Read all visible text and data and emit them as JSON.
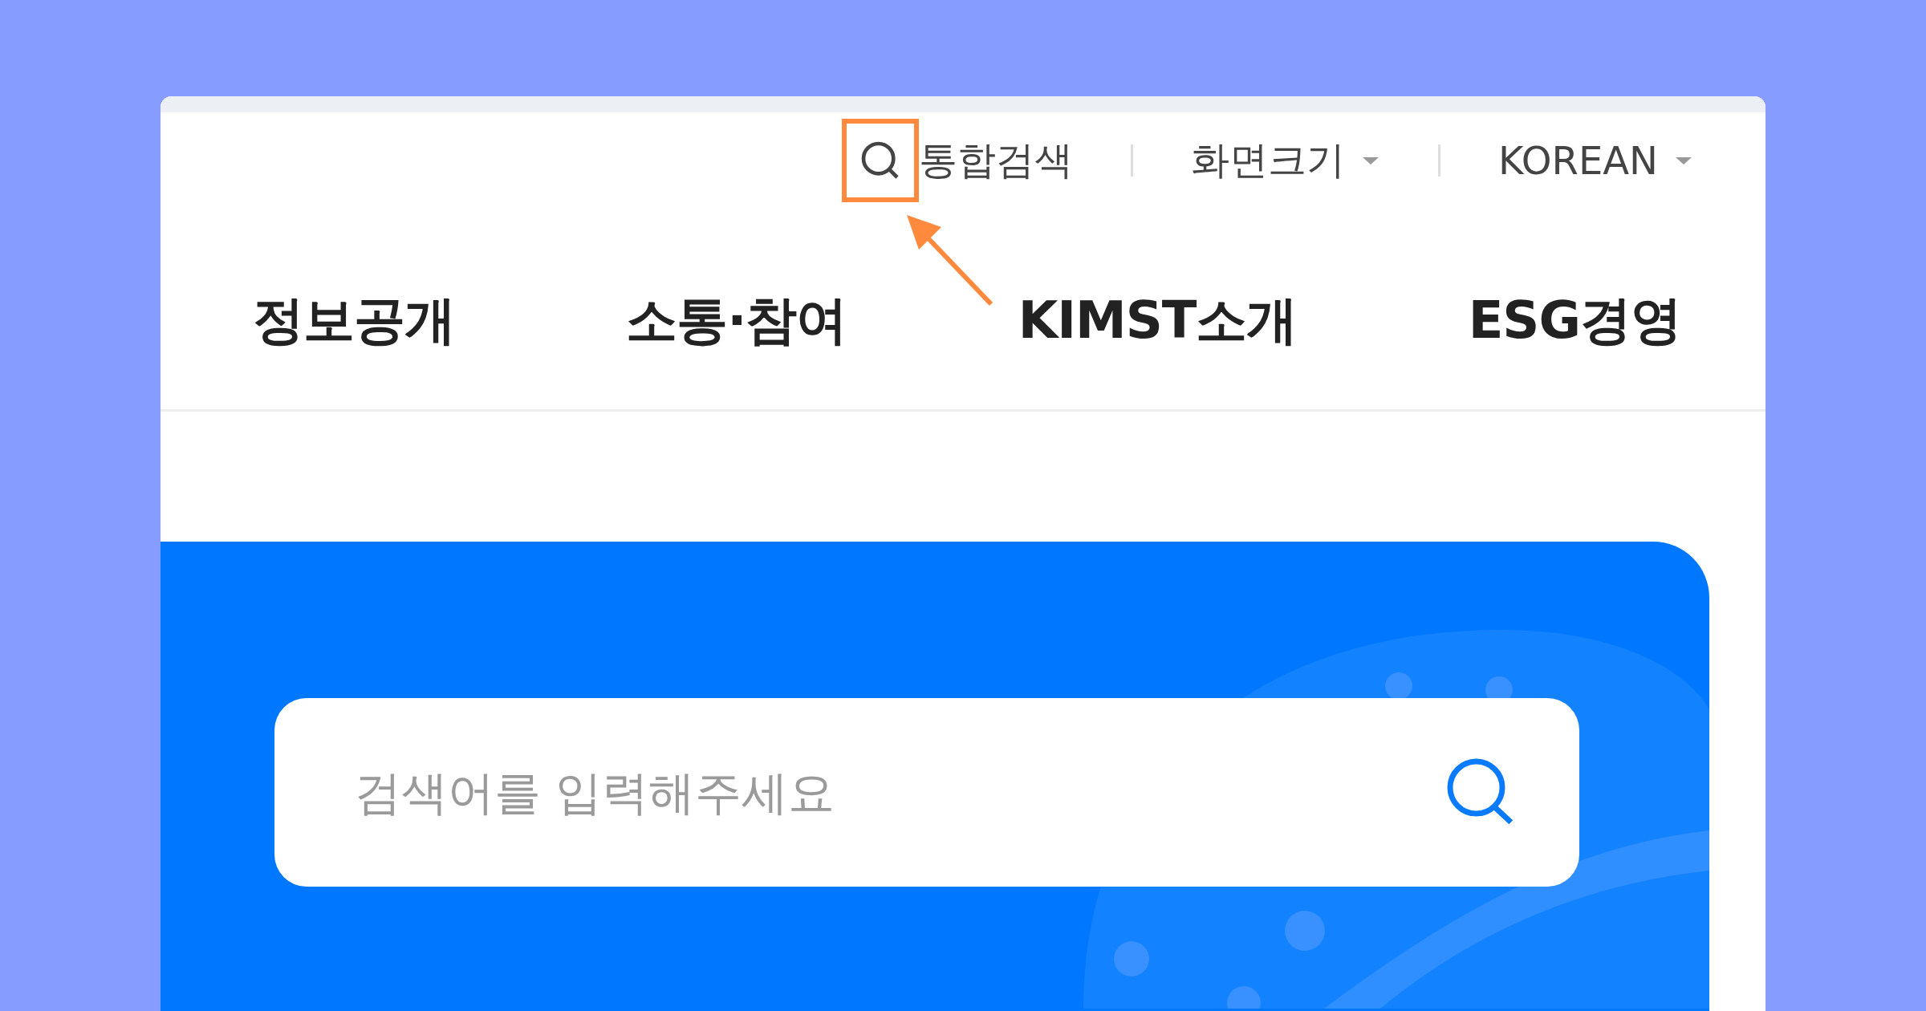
{
  "utility_links": [
    {
      "kind": "search",
      "label": "통합검색",
      "highlighted": true
    },
    {
      "kind": "dropdown",
      "label": "화면크기",
      "highlighted": false
    },
    {
      "kind": "dropdown",
      "label": "KOREAN",
      "highlighted": false
    }
  ],
  "main_menu": [
    {
      "label": "정보공개"
    },
    {
      "label": "소통·참여"
    },
    {
      "label": "KIMST소개"
    },
    {
      "label": "ESG경영"
    }
  ],
  "search": {
    "placeholder": "검색어를 입력해주세요"
  }
}
